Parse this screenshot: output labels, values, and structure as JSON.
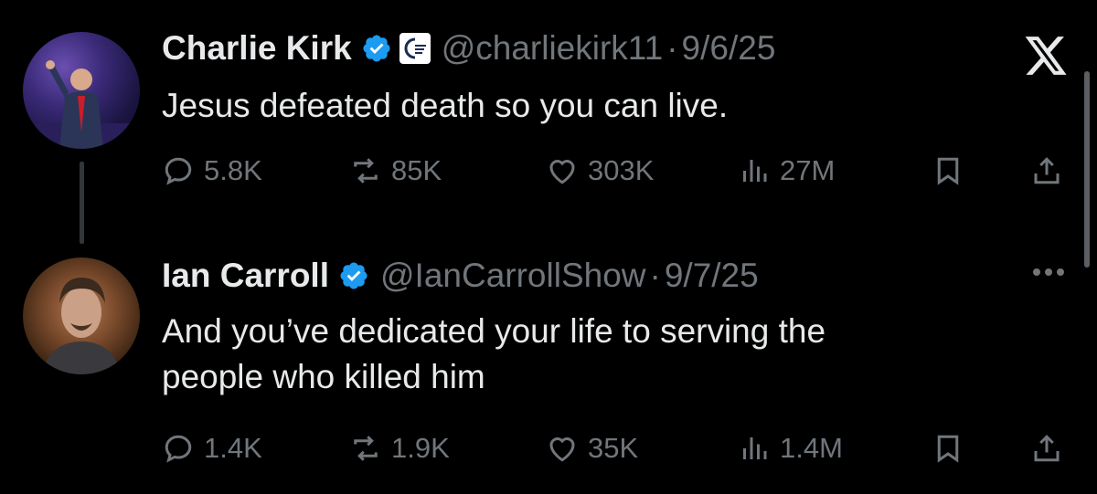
{
  "tweets": [
    {
      "name": "Charlie Kirk",
      "handle": "@charliekirk11",
      "separator": "·",
      "date": "9/6/25",
      "text": "Jesus defeated death so you can live.",
      "replies": "5.8K",
      "reposts": "85K",
      "likes": "303K",
      "views": "27M",
      "verified": true,
      "affiliation_badge": "turning-point-usa-badge"
    },
    {
      "name": "Ian Carroll",
      "handle": "@IanCarrollShow",
      "separator": "·",
      "date": "9/7/25",
      "text_line1": "And you’ve dedicated your life to serving the",
      "text_line2": "people who killed him",
      "replies": "1.4K",
      "reposts": "1.9K",
      "likes": "35K",
      "views": "1.4M",
      "verified": true
    }
  ],
  "colors": {
    "background": "#000000",
    "primary_text": "#e7e9ea",
    "secondary_text": "#71767b",
    "verified_blue": "#1d9bf0"
  },
  "icons": [
    "x-logo-icon",
    "reply-icon",
    "repost-icon",
    "like-icon",
    "views-icon",
    "bookmark-icon",
    "share-icon",
    "verified-badge-icon",
    "more-options-icon"
  ]
}
